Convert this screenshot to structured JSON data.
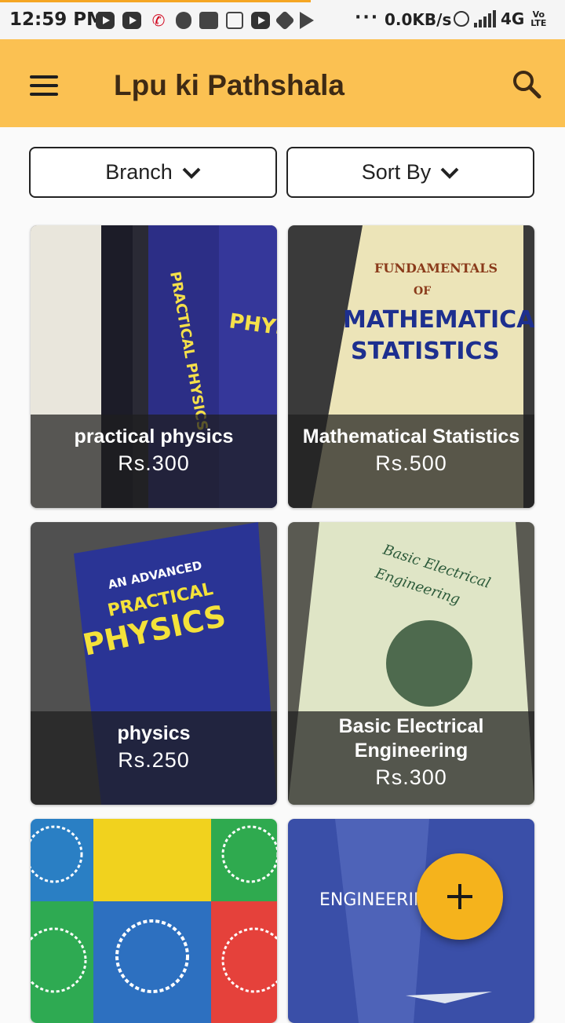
{
  "status_bar": {
    "time": "12:59 PM",
    "dots": "···",
    "speed": "0.0KB/s",
    "network": "4G",
    "volte": "Vo LTE"
  },
  "app_bar": {
    "title": "Lpu ki Pathshala",
    "menu_icon": "hamburger-menu-icon",
    "search_icon": "search-icon"
  },
  "filters": {
    "branch_label": "Branch",
    "sort_label": "Sort By"
  },
  "listings": [
    {
      "title": "practical physics",
      "price": "Rs.300"
    },
    {
      "title": "Mathematical Statistics",
      "price": "Rs.500"
    },
    {
      "title": "physics",
      "price": "Rs.250"
    },
    {
      "title": "Basic Electrical Engineering",
      "price": "Rs.300"
    },
    {
      "title": "",
      "price": ""
    },
    {
      "title": "",
      "price": ""
    }
  ],
  "fab": {
    "icon": "plus-icon"
  },
  "colors": {
    "app_bar": "#fbc152",
    "title_text": "#3e2a14",
    "fab": "#f5b31c"
  }
}
